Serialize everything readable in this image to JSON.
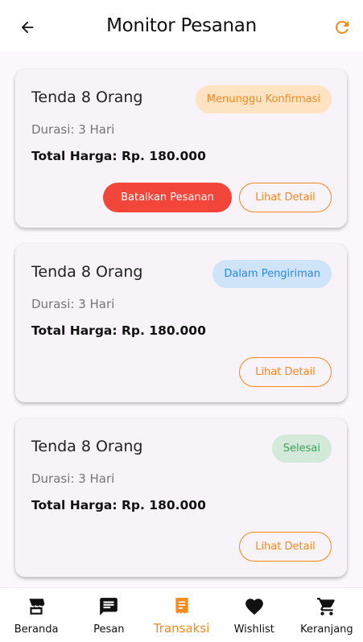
{
  "header": {
    "title": "Monitor Pesanan",
    "back_icon": "arrow-left-icon",
    "refresh_icon": "refresh-icon"
  },
  "colors": {
    "accent": "#f5891c",
    "danger": "#f3463b",
    "pending_bg": "#fde3c2",
    "shipping_bg": "#cfe3f9",
    "shipping_fg": "#2a8ce4",
    "done_bg": "#d3eadb",
    "done_fg": "#3e9f58"
  },
  "orders": [
    {
      "name": "Tenda 8 Orang",
      "status": "Menunggu Konfirmasi",
      "duration": "Durasi: 3 Hari",
      "total": "Total Harga: Rp. 180.000",
      "cancel_label": "Batalkan Pesanan",
      "detail_label": "Lihat Detail"
    },
    {
      "name": "Tenda 8 Orang",
      "status": "Dalam Pengiriman",
      "duration": "Durasi: 3 Hari",
      "total": "Total Harga: Rp. 180.000",
      "detail_label": "Lihat Detail"
    },
    {
      "name": "Tenda 8 Orang",
      "status": "Selesai",
      "duration": "Durasi: 3 Hari",
      "total": "Total Harga: Rp. 180.000",
      "detail_label": "Lihat Detail"
    }
  ],
  "nav": [
    {
      "label": "Beranda",
      "icon": "store-icon"
    },
    {
      "label": "Pesan",
      "icon": "chat-icon"
    },
    {
      "label": "Transaksi",
      "icon": "receipt-icon",
      "active": true
    },
    {
      "label": "Wishlist",
      "icon": "heart-icon"
    },
    {
      "label": "Keranjang",
      "icon": "cart-icon"
    }
  ]
}
